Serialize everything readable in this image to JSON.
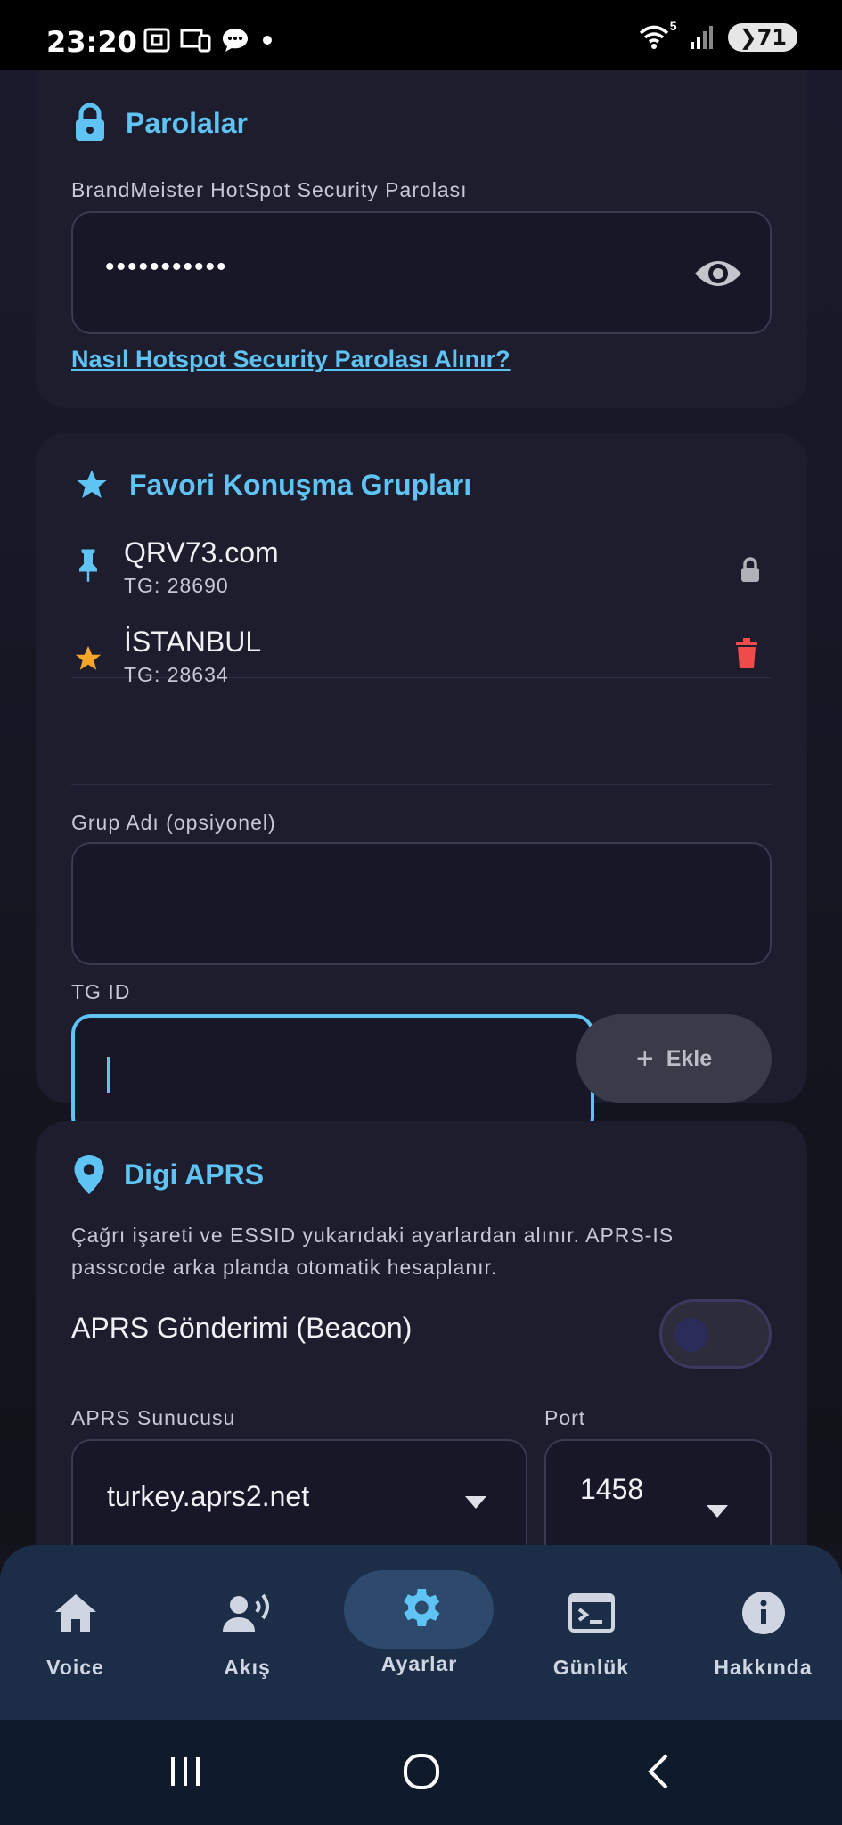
{
  "status_bar": {
    "time": "23:20",
    "battery": "71",
    "wifi_badge": "5"
  },
  "passwords": {
    "title": "Parolalar",
    "field_label": "BrandMeister HotSpot Security Parolası",
    "password_value": "•••••••••••",
    "help_link": "Nasıl Hotspot Security Parolası Alınır?"
  },
  "favorites": {
    "title": "Favori Konuşma Grupları",
    "groups": [
      {
        "name": "QRV73.com",
        "tg": "TG: 28690",
        "icon": "pin-icon",
        "action_icon": "lock-icon"
      },
      {
        "name": "İSTANBUL",
        "tg": "TG: 28634",
        "icon": "star-icon",
        "action_icon": "trash-icon"
      }
    ],
    "group_name_label": "Grup Adı (opsiyonel)",
    "tg_id_label": "TG ID",
    "add_label": "Ekle"
  },
  "aprs": {
    "title": "Digi APRS",
    "description_line1": "Çağrı işareti ve ESSID yukarıdaki ayarlardan alınır. APRS-IS",
    "description_line2": "passcode arka planda otomatik hesaplanır.",
    "beacon_label": "APRS Gönderimi (Beacon)",
    "beacon_enabled": false,
    "server_label": "APRS Sunucusu",
    "server_value": "turkey.aprs2.net",
    "port_label": "Port",
    "port_value": "1458"
  },
  "nav": {
    "items": [
      {
        "label": "Voice",
        "icon": "home-icon"
      },
      {
        "label": "Akış",
        "icon": "voice-activity-icon"
      },
      {
        "label": "Ayarlar",
        "icon": "gear-icon",
        "active": true
      },
      {
        "label": "Günlük",
        "icon": "terminal-icon"
      },
      {
        "label": "Hakkında",
        "icon": "info-icon"
      }
    ]
  },
  "colors": {
    "accent": "#5fc4f4",
    "star": "#f4a62a",
    "delete": "#ef4b4b",
    "nav_bg": "#1b2d47"
  }
}
